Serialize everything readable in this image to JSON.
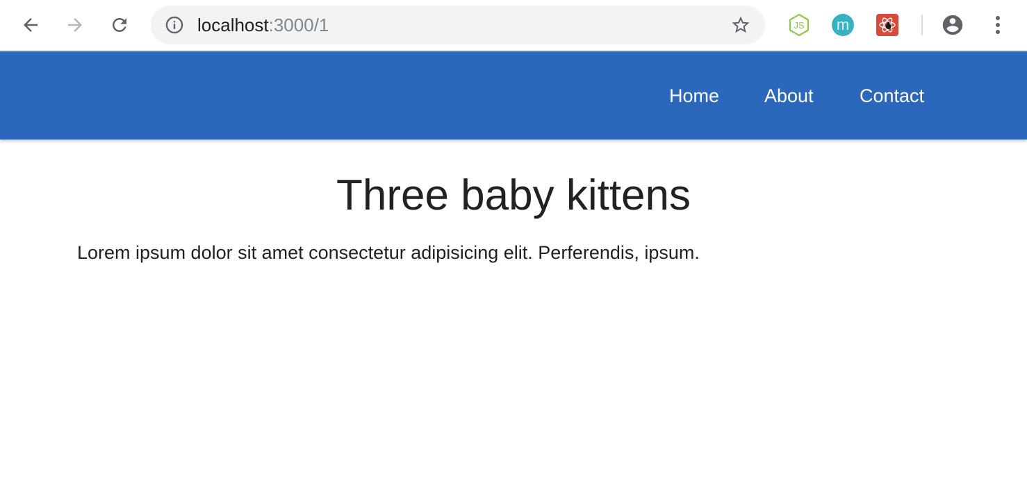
{
  "browser": {
    "back_icon": "arrow-left-icon",
    "forward_icon": "arrow-right-icon",
    "reload_icon": "reload-icon",
    "address_bar": {
      "host": "localhost",
      "path": ":3000/1",
      "security_icon": "info-circle-icon",
      "bookmark_icon": "star-outline-icon"
    },
    "extensions": [
      {
        "name": "nodejs-extension",
        "icon": "nodejs-hexagon-icon",
        "label": "JS",
        "color": "#8cc84b"
      },
      {
        "name": "m-extension",
        "icon": "m-circle-icon",
        "label": "m",
        "color": "#38b2c0"
      },
      {
        "name": "react-devtools-extension",
        "icon": "react-bug-icon",
        "color": "#d64a3b"
      }
    ],
    "profile_icon": "account-circle-icon",
    "menu_icon": "vertical-dots-icon"
  },
  "navbar": {
    "background_color": "#2b68bb",
    "links": [
      {
        "label": "Home"
      },
      {
        "label": "About"
      },
      {
        "label": "Contact"
      }
    ]
  },
  "main": {
    "title": "Three baby kittens",
    "body": "Lorem ipsum dolor sit amet consectetur adipisicing elit. Perferendis, ipsum."
  }
}
